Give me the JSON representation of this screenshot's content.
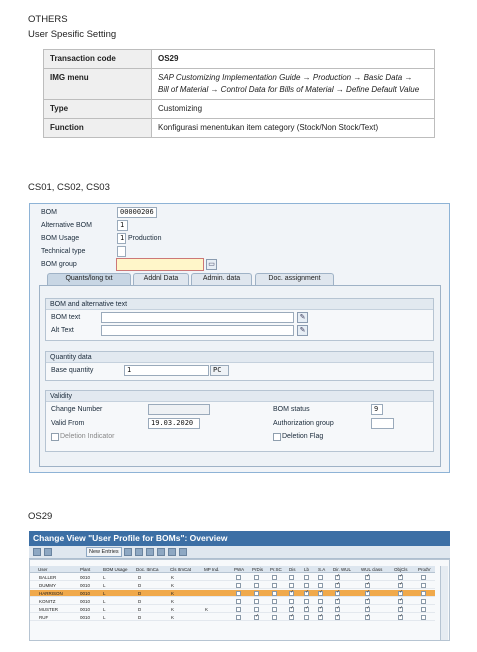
{
  "section": {
    "category": "OTHERS",
    "subtitle": "User Spesific Setting"
  },
  "info_table": [
    {
      "key": "Transaction code",
      "value": "OS29",
      "style": "bold"
    },
    {
      "key": "IMG menu",
      "value": "SAP Customizing Implementation Guide → Production → Basic Data → Bill of Material → Control Data for Bills of Material → Define Default Value",
      "style": "italic"
    },
    {
      "key": "Type",
      "value": "Customizing",
      "style": "normal"
    },
    {
      "key": "Function",
      "value": "Konfigurasi menentukan item category (Stock/Non Stock/Text)",
      "style": "normal"
    }
  ],
  "cs_heading": "CS01, CS02, CS03",
  "cs_screen": {
    "bom_label": "BOM",
    "bom_value": "00000206",
    "alt_bom_label": "Alternative BOM",
    "alt_bom_value": "1",
    "usage_label": "BOM Usage",
    "usage_value": "1",
    "usage_text": "Production",
    "tech_type_label": "Technical type",
    "bom_group_label": "BOM group",
    "tabs": [
      "Quants/long txt",
      "Addnl Data",
      "Admin. data",
      "Doc. assignment"
    ],
    "group_bom_alt": "BOM and alternative text",
    "bom_text_label": "BOM text",
    "alt_text_label": "Alt Text",
    "group_qty": "Quantity data",
    "base_qty_label": "Base quantity",
    "base_qty_value": "1",
    "base_qty_unit": "PC",
    "group_validity": "Validity",
    "change_number_label": "Change Number",
    "valid_from_label": "Valid From",
    "valid_from_value": "19.03.2020",
    "deletion_indicator_label": "Deletion Indicator",
    "bom_status_label": "BOM status",
    "bom_status_value": "9",
    "auth_group_label": "Authorization group",
    "deletion_flag_label": "Deletion Flag"
  },
  "os_heading": "OS29",
  "os_screen": {
    "title": "Change View \"User Profile for BOMs\": Overview",
    "new_entries": "New Entries",
    "columns": [
      "User",
      "Plant",
      "BOM Usage",
      "Doc. ItmCa",
      "Cls ItmCat",
      "MP Ind.",
      "PWA",
      "PrDis",
      "Pr.SC",
      "Dis",
      "Lb",
      "S.A",
      "Dir. WUL",
      "WUL class",
      "ObjCls",
      "ProdV"
    ],
    "rows": [
      {
        "user": "BALLER",
        "plant": "0010",
        "usage": "L",
        "doc": "D",
        "cls": "K",
        "mp": "",
        "checks": [
          0,
          0,
          0,
          0,
          0,
          0,
          1,
          1,
          1,
          0
        ],
        "highlight": false
      },
      {
        "user": "DUMMY",
        "plant": "0010",
        "usage": "L",
        "doc": "D",
        "cls": "K",
        "mp": "",
        "checks": [
          0,
          0,
          0,
          0,
          0,
          0,
          1,
          1,
          1,
          0
        ],
        "highlight": false
      },
      {
        "user": "HARRISON",
        "plant": "0010",
        "usage": "L",
        "doc": "D",
        "cls": "K",
        "mp": "",
        "checks": [
          0,
          0,
          0,
          1,
          1,
          1,
          1,
          1,
          1,
          0
        ],
        "highlight": true
      },
      {
        "user": "KONITZ",
        "plant": "0010",
        "usage": "L",
        "doc": "D",
        "cls": "K",
        "mp": "",
        "checks": [
          0,
          0,
          0,
          0,
          0,
          0,
          1,
          1,
          1,
          0
        ],
        "highlight": false
      },
      {
        "user": "MUSTER",
        "plant": "0010",
        "usage": "L",
        "doc": "D",
        "cls": "K",
        "mp": "K",
        "checks": [
          0,
          0,
          0,
          1,
          1,
          1,
          1,
          1,
          1,
          0
        ],
        "highlight": false
      },
      {
        "user": "RUF",
        "plant": "0010",
        "usage": "L",
        "doc": "D",
        "cls": "K",
        "mp": "",
        "checks": [
          0,
          1,
          0,
          1,
          0,
          1,
          1,
          1,
          1,
          0
        ],
        "highlight": false
      }
    ]
  }
}
